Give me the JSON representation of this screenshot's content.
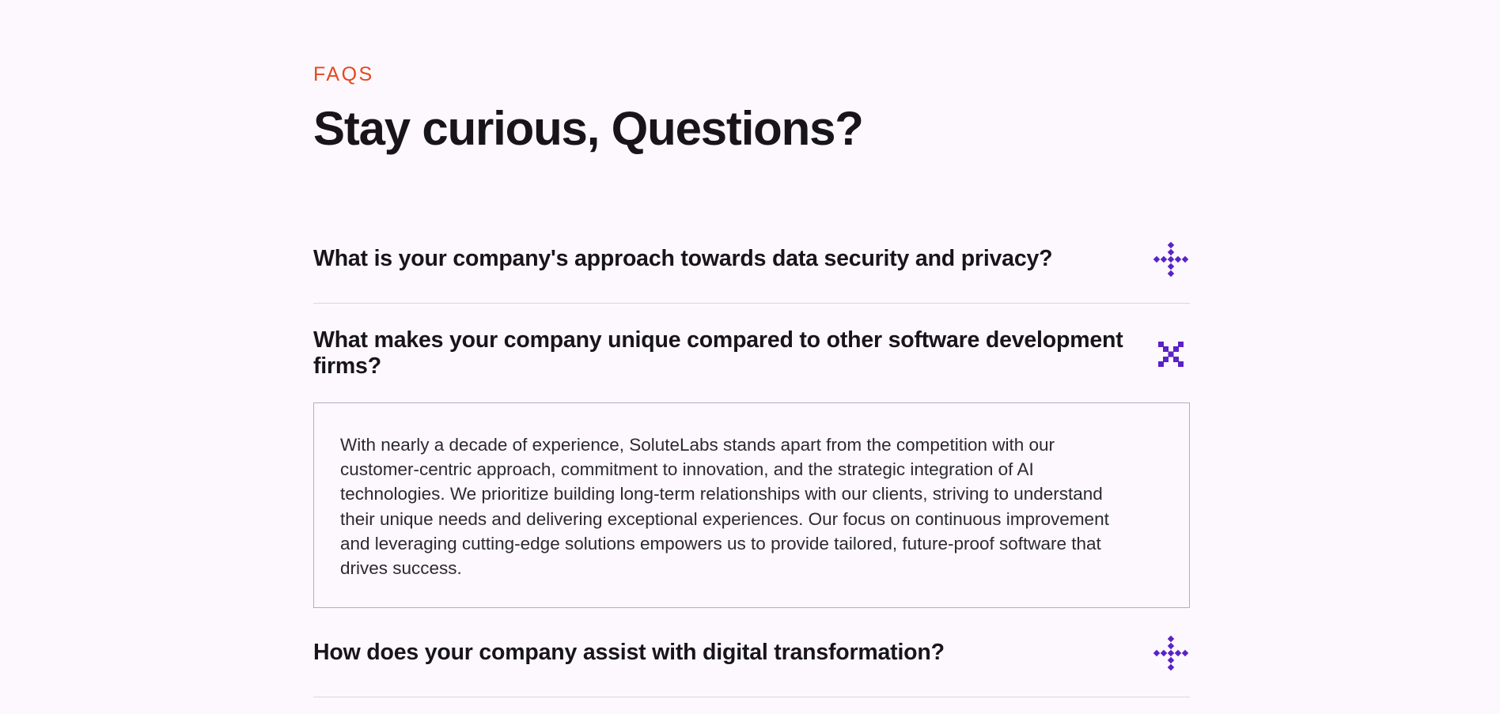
{
  "section": {
    "eyebrow": "FAQS",
    "title": "Stay curious, Questions?"
  },
  "faqs": [
    {
      "question": "What is your company's approach towards data security and privacy?",
      "state": "collapsed",
      "toggle_icon": "expand-plus-icon"
    },
    {
      "question": "What makes your company unique compared to other software development firms?",
      "state": "expanded",
      "toggle_icon": "collapse-x-icon",
      "answer": "With nearly a decade of experience, SoluteLabs stands apart from the competition with our customer-centric approach, commitment to innovation, and the strategic integration of AI technologies. We prioritize building long-term relationships with our clients, striving to understand their unique needs and delivering exceptional experiences. Our focus on continuous improvement and leveraging cutting-edge solutions empowers us to provide tailored, future-proof software that drives success."
    },
    {
      "question": "How does your company assist with digital transformation?",
      "state": "collapsed",
      "toggle_icon": "expand-plus-icon"
    }
  ],
  "colors": {
    "accent": "#e5481f",
    "icon": "#5a22c7",
    "background": "#fcf8fd",
    "text": "#17151b"
  }
}
